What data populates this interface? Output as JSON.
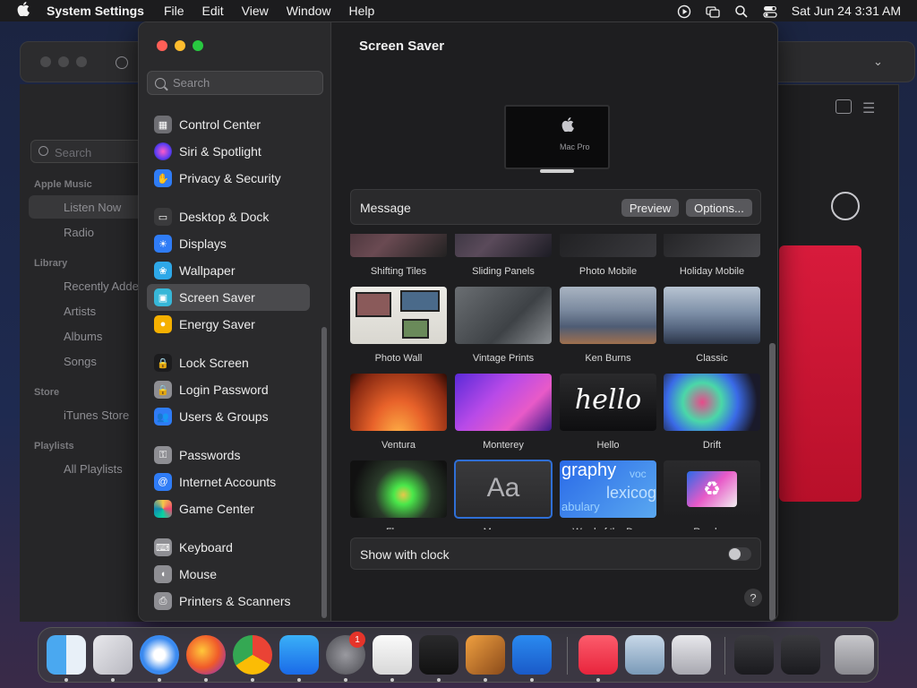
{
  "menubar": {
    "app_name": "System Settings",
    "menus": [
      "File",
      "Edit",
      "View",
      "Window",
      "Help"
    ],
    "datetime": "Sat Jun 24  3:31 AM"
  },
  "bg_music": {
    "search_placeholder": "Search",
    "sections": [
      {
        "header": "Apple Music",
        "items": [
          "Listen Now",
          "Radio"
        ]
      },
      {
        "header": "Library",
        "items": [
          "Recently Added",
          "Artists",
          "Albums",
          "Songs"
        ]
      },
      {
        "header": "Store",
        "items": [
          "iTunes Store"
        ]
      },
      {
        "header": "Playlists",
        "items": [
          "All Playlists"
        ]
      }
    ]
  },
  "sidebar": {
    "search_placeholder": "Search",
    "items": [
      {
        "label": "Control Center",
        "icon": "control-center-icon",
        "color": "#6e6e73"
      },
      {
        "label": "Siri & Spotlight",
        "icon": "siri-icon",
        "color": "#b04ad8"
      },
      {
        "label": "Privacy & Security",
        "icon": "hand-icon",
        "color": "#2f7cf6"
      },
      {
        "label": "Desktop & Dock",
        "icon": "desktop-dock-icon",
        "color": "#3a3a3c"
      },
      {
        "label": "Displays",
        "icon": "sun-icon",
        "color": "#2f7cf6"
      },
      {
        "label": "Wallpaper",
        "icon": "flower-icon",
        "color": "#2ea8e8"
      },
      {
        "label": "Screen Saver",
        "icon": "screen-saver-icon",
        "color": "#37b7d8"
      },
      {
        "label": "Energy Saver",
        "icon": "lightbulb-icon",
        "color": "#f5b000"
      },
      {
        "label": "Lock Screen",
        "icon": "lock-icon",
        "color": "#1c1c1e"
      },
      {
        "label": "Login Password",
        "icon": "lock-icon",
        "color": "#8e8e93"
      },
      {
        "label": "Users & Groups",
        "icon": "users-icon",
        "color": "#2f7cf6"
      },
      {
        "label": "Passwords",
        "icon": "key-icon",
        "color": "#8e8e93"
      },
      {
        "label": "Internet Accounts",
        "icon": "at-icon",
        "color": "#2f7cf6"
      },
      {
        "label": "Game Center",
        "icon": "game-center-icon",
        "color": "#e8e8e8"
      },
      {
        "label": "Keyboard",
        "icon": "keyboard-icon",
        "color": "#8e8e93"
      },
      {
        "label": "Mouse",
        "icon": "mouse-icon",
        "color": "#8e8e93"
      },
      {
        "label": "Printers & Scanners",
        "icon": "printer-icon",
        "color": "#8e8e93"
      }
    ],
    "selected": "Screen Saver"
  },
  "main": {
    "title": "Screen Saver",
    "preview_label": "Mac Pro",
    "message_label": "Message",
    "preview_button": "Preview",
    "options_button": "Options...",
    "savers": [
      {
        "label": "Shifting Tiles"
      },
      {
        "label": "Sliding Panels"
      },
      {
        "label": "Photo Mobile"
      },
      {
        "label": "Holiday Mobile"
      },
      {
        "label": "Photo Wall"
      },
      {
        "label": "Vintage Prints"
      },
      {
        "label": "Ken Burns"
      },
      {
        "label": "Classic"
      },
      {
        "label": "Ventura"
      },
      {
        "label": "Monterey"
      },
      {
        "label": "Hello"
      },
      {
        "label": "Drift"
      },
      {
        "label": "Flurry"
      },
      {
        "label": "Message"
      },
      {
        "label": "Word of the Day"
      },
      {
        "label": "Random"
      }
    ],
    "selected_saver": "Message",
    "hello_text": "hello",
    "message_thumb_text": "Aa",
    "word_thumb_text": [
      "graphy",
      "voc",
      "lexicog",
      "abulary"
    ],
    "show_clock_label": "Show with clock",
    "show_clock": false,
    "help": "?"
  },
  "dock": {
    "apps": [
      "Finder",
      "Launchpad",
      "Safari",
      "Firefox",
      "Chrome",
      "App Store",
      "System Settings",
      "TextEdit",
      "Terminal",
      "GarageBand",
      "Visual Studio Code",
      "Music",
      "Preview",
      "Screenshot",
      "Downloads",
      "Documents",
      "Trash"
    ],
    "settings_badge": "1"
  }
}
